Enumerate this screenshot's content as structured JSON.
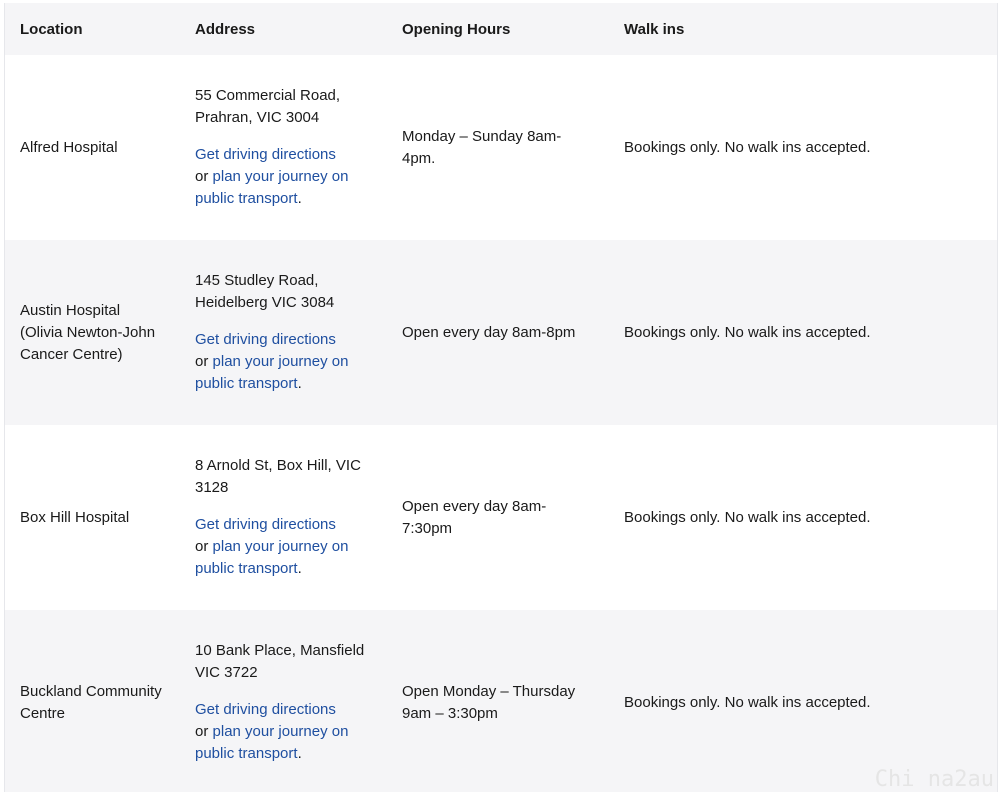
{
  "table": {
    "headers": [
      "Location",
      "Address",
      "Opening Hours",
      "Walk ins"
    ],
    "rows": [
      {
        "location": "Alfred Hospital",
        "address": "55 Commercial Road, Prahran, VIC 3004",
        "directions_link": "Get driving directions",
        "or_text": "or ",
        "transport_link": "plan your journey on public transport",
        "period": ".",
        "hours": "Monday – Sunday 8am-4pm.",
        "walkins": "Bookings only. No walk ins accepted."
      },
      {
        "location": "Austin Hospital (Olivia Newton-John Cancer Centre)",
        "address": "145 Studley Road, Heidelberg VIC 3084",
        "directions_link": "Get driving directions",
        "or_text": "or ",
        "transport_link": "plan your journey on public transport",
        "period": ".",
        "hours": "Open every day 8am-8pm",
        "walkins": "Bookings only. No walk ins accepted."
      },
      {
        "location": "Box Hill Hospital",
        "address": "8 Arnold St, Box Hill, VIC 3128",
        "directions_link": "Get driving directions",
        "or_text": "or ",
        "transport_link": "plan your journey on public transport",
        "period": ".",
        "hours": "Open every day 8am-7:30pm",
        "walkins": "Bookings only. No walk ins accepted."
      },
      {
        "location": "Buckland Community Centre",
        "address": "10 Bank Place, Mansfield VIC 3722",
        "directions_link": "Get driving directions",
        "or_text": "or ",
        "transport_link": "plan your journey on public transport",
        "period": ".",
        "hours": "Open Monday – Thursday 9am – 3:30pm",
        "walkins": "Bookings only. No walk ins accepted."
      }
    ]
  },
  "watermark": "Chi na2au",
  "colors": {
    "link": "#1f4fa0",
    "stripe": "#f5f5f7",
    "text": "#1a1a1a"
  }
}
